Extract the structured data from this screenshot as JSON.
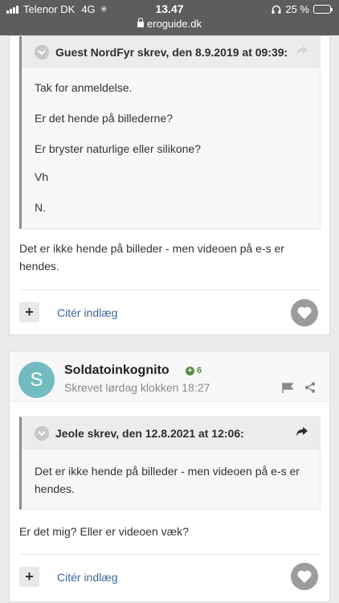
{
  "status_bar": {
    "carrier": "Telenor DK",
    "network": "4G",
    "time": "13.47",
    "url": "eroguide.dk",
    "battery": "25 %",
    "battery_level": 0.25
  },
  "posts": [
    {
      "quote": {
        "header": "Guest NordFyr skrev, den 8.9.2019 at 09:39:",
        "lines": [
          "Tak for anmeldelse.",
          "Er det hende på billederne?",
          "Er bryster naturlige eller silikone?",
          "Vh",
          "N."
        ]
      },
      "text": "Det er ikke hende på billeder - men videoen  på e-s er hendes.",
      "plus_label": "+",
      "cite_label": "Citér indlæg"
    },
    {
      "author": {
        "initial": "S",
        "name": "Soldatoinkognito",
        "reputation": "6",
        "date": "Skrevet lørdag klokken 18:27"
      },
      "quote": {
        "header": "Jeole skrev, den 12.8.2021 at 12:06:",
        "text": "Det er ikke hende på billeder - men videoen  på e-s er hendes."
      },
      "text": "Er det mig? Eller er videoen væk?",
      "plus_label": "+",
      "cite_label": "Citér indlæg"
    }
  ],
  "colors": {
    "link": "#3d6594",
    "avatar": "#70bcc0",
    "reputation": "#5a8c3f",
    "like_button": "#9c9c9c"
  },
  "icons": [
    "signal-icon",
    "wifi-icon",
    "lock-icon",
    "headphones-icon",
    "battery-icon",
    "chevron-down-icon",
    "share-arrow-icon",
    "heart-icon",
    "plus-icon",
    "flag-icon",
    "share-icon",
    "reputation-icon"
  ]
}
